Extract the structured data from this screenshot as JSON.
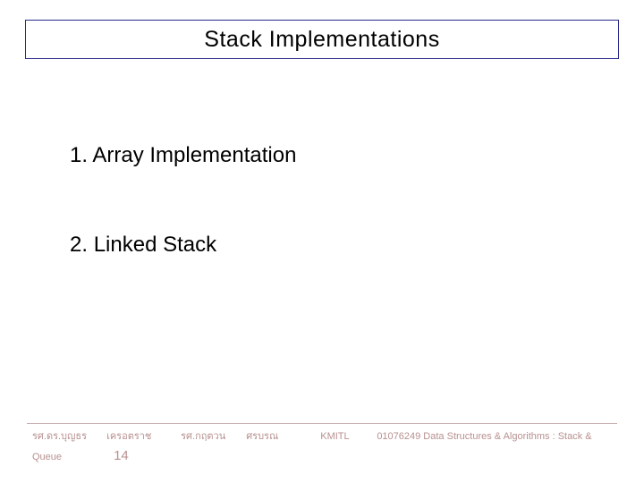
{
  "title": "Stack Implementations",
  "items": [
    {
      "num": "1.",
      "text": "Array Implementation"
    },
    {
      "num": "2.",
      "text": "Linked Stack"
    }
  ],
  "footer": {
    "author": "รศ.ดร.บุญธร",
    "name1": "เครอตราช",
    "name2": "รศ.กฤตวน",
    "name3": "ศรบรณ",
    "institution": "KMITL",
    "course": "01076249 Data Structures & Algorithms : Stack &",
    "queue": "Queue",
    "page": "14"
  }
}
